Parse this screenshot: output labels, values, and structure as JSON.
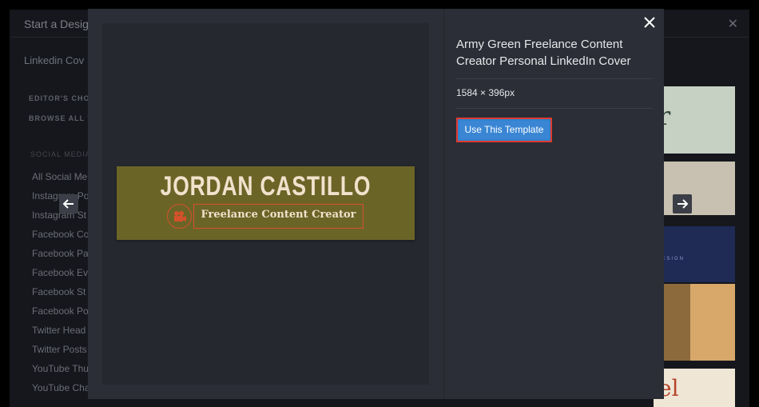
{
  "background": {
    "title": "Start a Desig",
    "search_value": "Linkedin Cov",
    "links": [
      "EDITOR'S CHOI",
      "BROWSE ALL T"
    ],
    "section_heading": "SOCIAL MEDIA",
    "items": [
      "All Social Me",
      "Instagram Po",
      "Instagram St",
      "Facebook Co",
      "Facebook Pa",
      "Facebook Ev",
      "Facebook St",
      "Facebook Po",
      "Twitter Head",
      "Twitter Posts",
      "YouTube Thu",
      "YouTube Cha"
    ],
    "thumb_texts": [
      "r",
      "DESIGN",
      "el"
    ]
  },
  "template": {
    "title": "Army Green Freelance Content Creator Personal LinkedIn Cover",
    "dimensions": "1584 × 396px",
    "use_button": "Use This Template",
    "preview": {
      "name": "JORDAN CASTILLO",
      "subtitle": "Freelance Content Creator"
    }
  },
  "icons": {
    "close": "close-icon",
    "prev": "arrow-left-icon",
    "next": "arrow-right-icon",
    "camera": "camera-icon"
  },
  "colors": {
    "cover_bg": "#6b6427",
    "accent_orange": "#d5512b",
    "button_blue": "#3a86d4",
    "button_outline": "#e03a2f"
  }
}
